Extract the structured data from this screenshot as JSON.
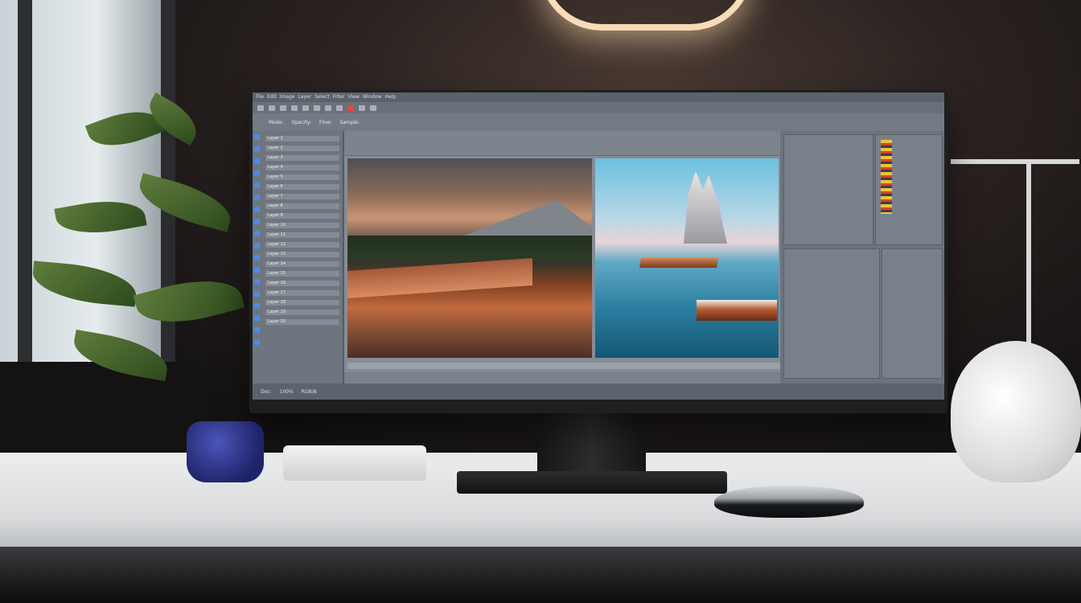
{
  "app": {
    "menu_items": [
      "File",
      "Edit",
      "Image",
      "Layer",
      "Select",
      "Filter",
      "View",
      "Window",
      "Help"
    ],
    "options_items": [
      "Mode:",
      "Opacity:",
      "Flow:",
      "Sample:"
    ],
    "status_items": [
      "Doc:",
      "100%",
      "RGB/8"
    ],
    "layers": [
      "Layer 1",
      "Layer 2",
      "Layer 3",
      "Layer 4",
      "Layer 5",
      "Layer 6",
      "Layer 7",
      "Layer 8",
      "Layer 9",
      "Layer 10",
      "Layer 11",
      "Layer 12",
      "Layer 13",
      "Layer 14",
      "Layer 15",
      "Layer 16",
      "Layer 17",
      "Layer 18",
      "Layer 19",
      "Layer 20"
    ],
    "properties": [
      "",
      "",
      "",
      "",
      "",
      "",
      "",
      "",
      "",
      ""
    ],
    "accent_color": "#e84545",
    "tool_color": "#4b8be0"
  }
}
